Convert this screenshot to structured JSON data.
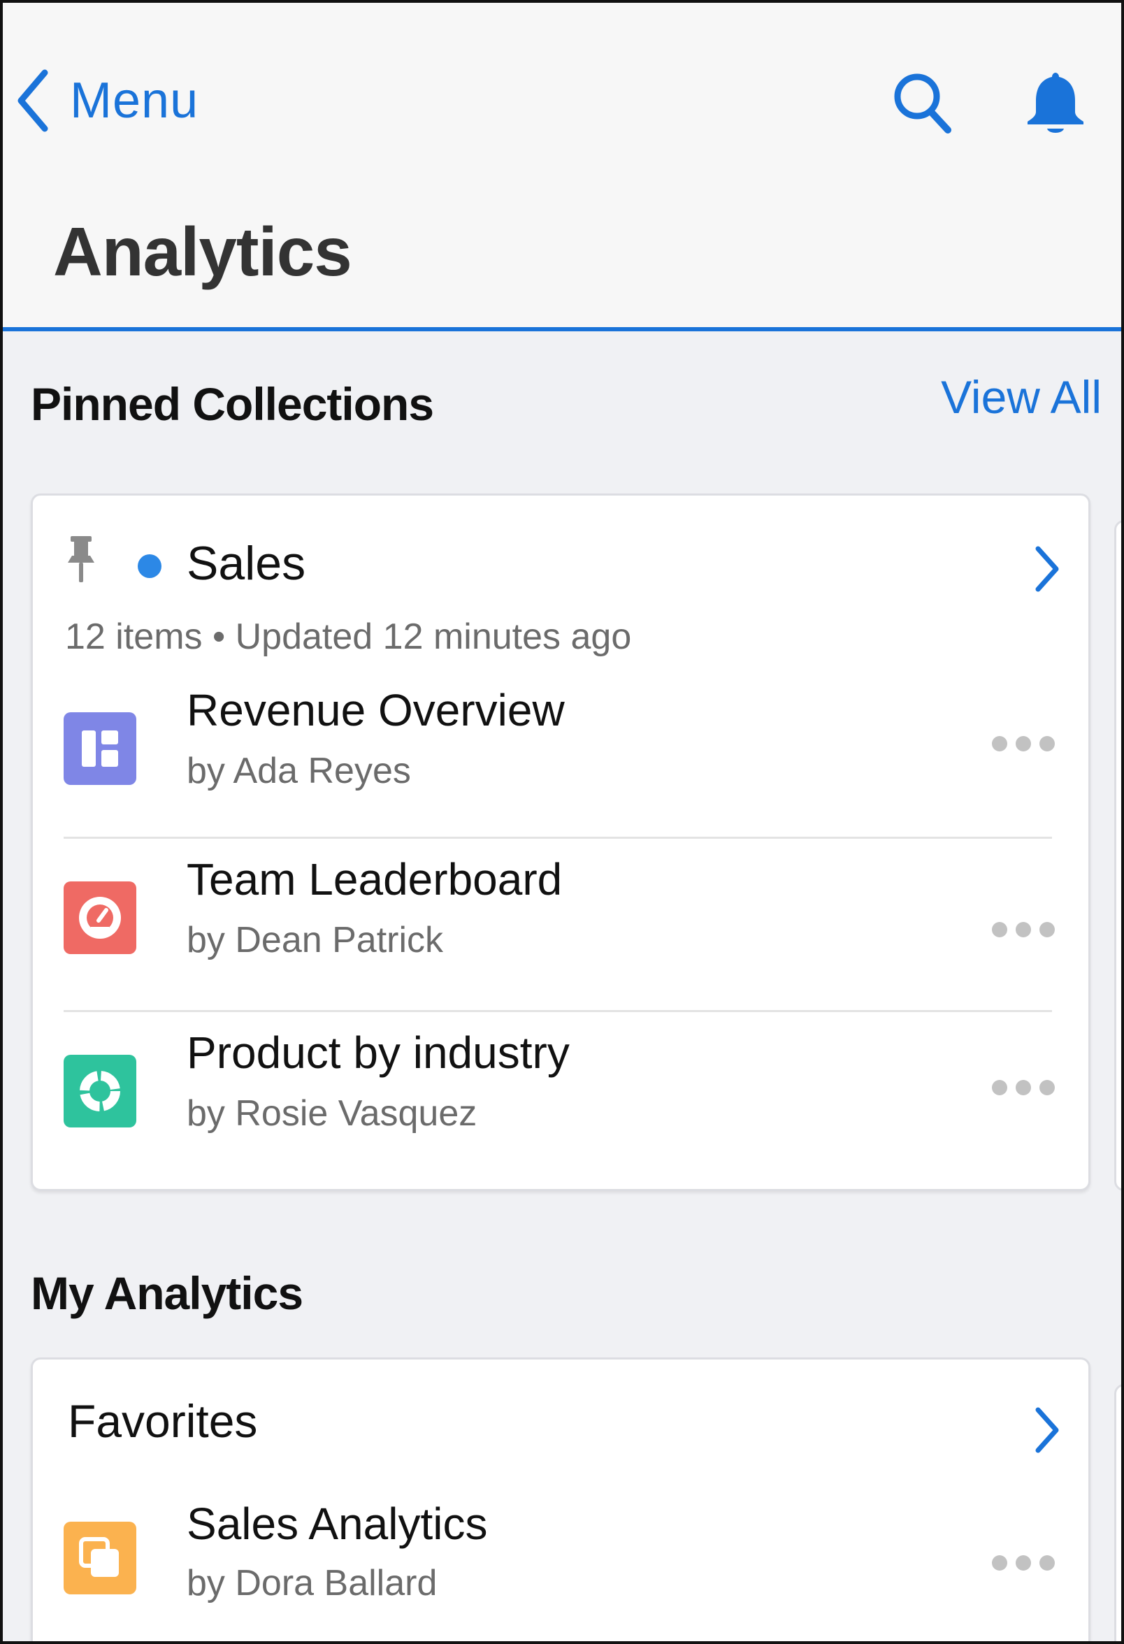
{
  "header": {
    "back_label": "Menu",
    "title": "Analytics",
    "icons": [
      "chevron-left-icon",
      "search-icon",
      "bell-icon"
    ],
    "accent_color": "#1a73d9"
  },
  "pinned": {
    "section_title": "Pinned Collections",
    "view_all_label": "View All",
    "collection": {
      "name": "Sales",
      "meta": "12 items • Updated 12 minutes ago",
      "status_dot_color": "#2c88e6",
      "items": [
        {
          "title": "Revenue Overview",
          "author": "by Ada Reyes",
          "icon": "dashboard-icon",
          "color": "#7f86e6"
        },
        {
          "title": "Team Leaderboard",
          "author": "by Dean Patrick",
          "icon": "gauge-icon",
          "color": "#ef6a64"
        },
        {
          "title": "Product by industry",
          "author": "by Rosie Vasquez",
          "icon": "donut-chart-icon",
          "color": "#2ec39d"
        }
      ]
    }
  },
  "my_analytics": {
    "section_title": "My Analytics",
    "favorites": {
      "title": "Favorites",
      "items": [
        {
          "title": "Sales Analytics",
          "author": "by Dora Ballard",
          "icon": "copy-icon",
          "color": "#fbb24f"
        }
      ]
    }
  }
}
